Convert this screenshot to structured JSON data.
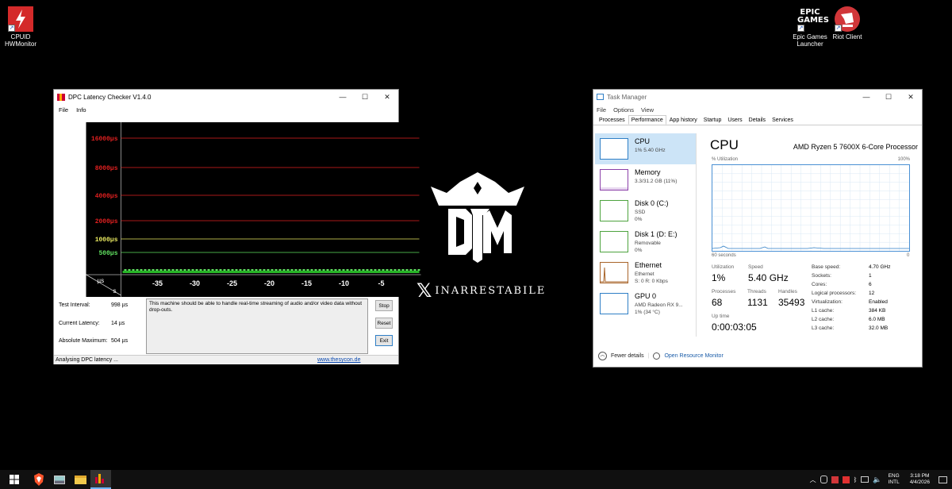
{
  "desktop": {
    "icons": [
      {
        "label": "CPUID\nHWMonitor",
        "name": "hwmonitor"
      },
      {
        "label": "Epic Games\nLauncher",
        "name": "epic"
      },
      {
        "label": "Riot Client",
        "name": "riot"
      }
    ],
    "epic_logo_text": "EPIC\nGAMES",
    "watermark_text": "INARRESTABILE"
  },
  "dpc": {
    "title": "DPC Latency Checker V1.4.0",
    "menu": [
      "File",
      "Info"
    ],
    "y_labels": [
      "16000µs",
      "8000µs",
      "4000µs",
      "2000µs",
      "1000µs",
      "500µs"
    ],
    "y_label_colors": [
      "#e02020",
      "#e02020",
      "#e02020",
      "#e02020",
      "#e8e860",
      "#60e060"
    ],
    "axis_corner_top": "µs",
    "axis_corner_bottom": "s",
    "x_ticks": [
      "-35",
      "-30",
      "-25",
      "-20",
      "-15",
      "-10",
      "-5"
    ],
    "labels": {
      "test_interval": "Test Interval:",
      "current_latency": "Current Latency:",
      "absolute_maximum": "Absolute Maximum:"
    },
    "values": {
      "test_interval": "998 µs",
      "current_latency": "14 µs",
      "absolute_maximum": "504 µs"
    },
    "message": "This machine should be able to handle real-time streaming of audio and/or video data without drop-outs.",
    "buttons": {
      "stop": "Stop",
      "reset": "Reset",
      "exit": "Exit"
    },
    "status": "Analysing DPC latency ...",
    "link": "www.thesycon.de"
  },
  "taskmanager": {
    "title": "Task Manager",
    "menu": [
      "File",
      "Options",
      "View"
    ],
    "tabs": [
      "Processes",
      "Performance",
      "App history",
      "Startup",
      "Users",
      "Details",
      "Services"
    ],
    "active_tab": "Performance",
    "sidebar": [
      {
        "name": "CPU",
        "sub1": "1%  5.40 GHz",
        "sub2": "",
        "color": "#2f7fc6"
      },
      {
        "name": "Memory",
        "sub1": "3.3/31.2 GB (11%)",
        "sub2": "",
        "color": "#8b3fa8"
      },
      {
        "name": "Disk 0 (C:)",
        "sub1": "SSD",
        "sub2": "0%",
        "color": "#4da33e"
      },
      {
        "name": "Disk 1 (D: E:)",
        "sub1": "Removable",
        "sub2": "0%",
        "color": "#4da33e"
      },
      {
        "name": "Ethernet",
        "sub1": "Ethernet",
        "sub2": "S: 0  R: 0 Kbps",
        "color": "#a8642a"
      },
      {
        "name": "GPU 0",
        "sub1": "AMD Radeon RX 9...",
        "sub2": "1% (34 °C)",
        "color": "#2f7fc6"
      }
    ],
    "cpu_title": "CPU",
    "cpu_model": "AMD Ryzen 5 7600X 6-Core Processor",
    "util_label": "% Utilization",
    "util_max": "100%",
    "graph_span": "60 seconds",
    "graph_min": "0",
    "stats": {
      "utilization_label": "Utilization",
      "utilization": "1%",
      "speed_label": "Speed",
      "speed": "5.40 GHz",
      "processes_label": "Processes",
      "processes": "68",
      "threads_label": "Threads",
      "threads": "1131",
      "handles_label": "Handles",
      "handles": "35493",
      "uptime_label": "Up time",
      "uptime": "0:00:03:05"
    },
    "specs": [
      {
        "k": "Base speed:",
        "v": "4.70 GHz"
      },
      {
        "k": "Sockets:",
        "v": "1"
      },
      {
        "k": "Cores:",
        "v": "6"
      },
      {
        "k": "Logical processors:",
        "v": "12"
      },
      {
        "k": "Virtualization:",
        "v": "Enabled"
      },
      {
        "k": "L1 cache:",
        "v": "384 KB"
      },
      {
        "k": "L2 cache:",
        "v": "6.0 MB"
      },
      {
        "k": "L3 cache:",
        "v": "32.0 MB"
      }
    ],
    "fewer_details": "Fewer details",
    "open_monitor": "Open Resource Monitor"
  },
  "taskbar": {
    "lang": "ENG",
    "layout": "INTL",
    "time": "3:18 PM",
    "date": "4/4/2026"
  }
}
